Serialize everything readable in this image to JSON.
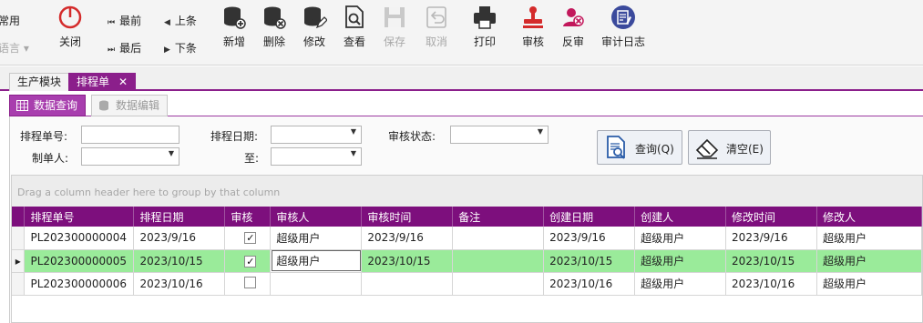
{
  "toolbar": {
    "common": "常用",
    "language": "语言",
    "close": "关闭",
    "first": "最前",
    "prev": "上条",
    "last": "最后",
    "next": "下条",
    "add": "新增",
    "delete": "删除",
    "edit": "修改",
    "view": "查看",
    "save": "保存",
    "cancel": "取消",
    "print": "打印",
    "audit": "审核",
    "unaudit": "反审",
    "audit_log": "审计日志"
  },
  "tabs": [
    {
      "label": "生产模块"
    },
    {
      "label": "排程单",
      "close": "✕"
    }
  ],
  "subtabs": [
    {
      "label": "数据查询"
    },
    {
      "label": "数据编辑"
    }
  ],
  "filters": {
    "schedule_no_label": "排程单号:",
    "schedule_date_label": "排程日期:",
    "audit_status_label": "审核状态:",
    "creator_label": "制单人:",
    "to_label": "至:"
  },
  "buttons": {
    "query": "查询(Q)",
    "clear": "清空(E)"
  },
  "grid": {
    "group_hint": "Drag a column header here to group by that column",
    "columns": [
      "排程单号",
      "排程日期",
      "审核",
      "审核人",
      "审核时间",
      "备注",
      "创建日期",
      "创建人",
      "修改时间",
      "修改人"
    ],
    "rows": [
      {
        "no": "PL202300000004",
        "date": "2023/9/16",
        "checked": "✓",
        "auditor": "超级用户",
        "audit_time": "2023/9/16",
        "remark": "",
        "created": "2023/9/16",
        "creator": "超级用户",
        "modified": "2023/9/16",
        "modifier": "超级用户"
      },
      {
        "no": "PL202300000005",
        "date": "2023/10/15",
        "checked": "✓",
        "auditor": "超级用户",
        "audit_time": "2023/10/15",
        "remark": "",
        "created": "2023/10/15",
        "creator": "超级用户",
        "modified": "2023/10/15",
        "modifier": "超级用户"
      },
      {
        "no": "PL202300000006",
        "date": "2023/10/16",
        "checked": "",
        "auditor": "",
        "audit_time": "",
        "remark": "",
        "created": "2023/10/16",
        "creator": "超级用户",
        "modified": "2023/10/16",
        "modifier": "超级用户"
      }
    ],
    "current_row_marker": "▸"
  },
  "colors": {
    "accent": "#8b1f8b",
    "header": "#7d0f7d",
    "selected_row": "#9aeb9a",
    "close_red": "#d42b2b"
  }
}
